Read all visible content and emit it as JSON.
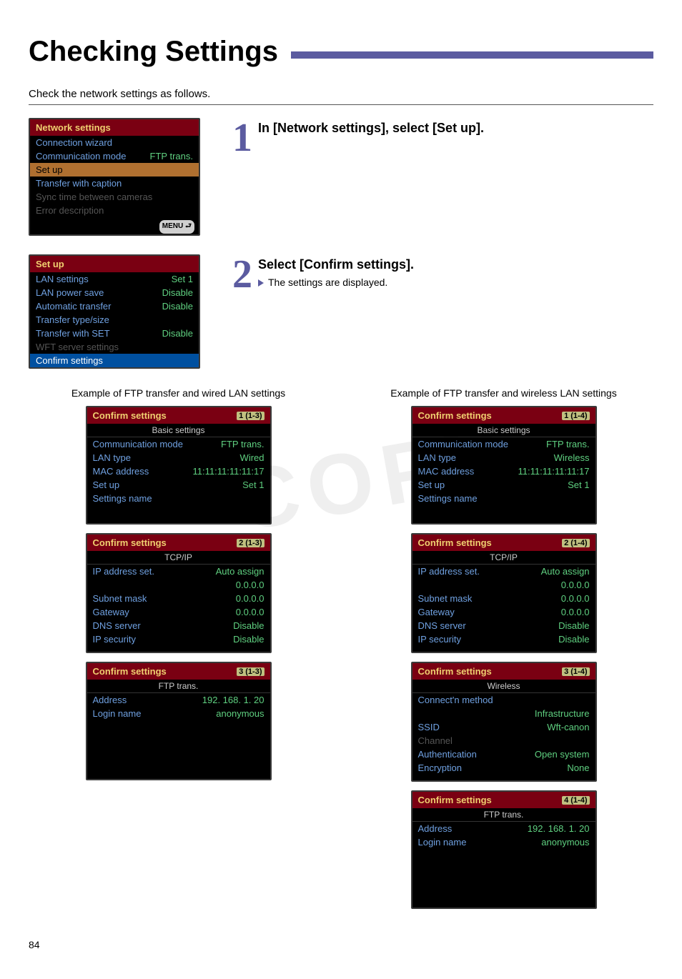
{
  "title": "Checking Settings",
  "intro": "Check the network settings as follows.",
  "page_number": "84",
  "step1": {
    "num": "1",
    "heading": "In [Network settings], select [Set up].",
    "panel": {
      "header": "Network settings",
      "items": [
        {
          "label": "Connection wizard",
          "value": ""
        },
        {
          "label": "Communication mode",
          "value": "FTP trans."
        },
        {
          "label": "Set up",
          "value": "",
          "hl": "orange"
        },
        {
          "label": "Transfer with caption",
          "value": ""
        },
        {
          "label": "Sync time between cameras",
          "value": "",
          "disabled": true
        },
        {
          "label": "Error description",
          "value": "",
          "disabled": true
        }
      ],
      "footer": "MENU ⮐"
    }
  },
  "step2": {
    "num": "2",
    "heading": "Select [Confirm settings].",
    "detail": "The settings are displayed.",
    "panel": {
      "header": "Set up",
      "items": [
        {
          "label": "LAN settings",
          "value": "Set 1"
        },
        {
          "label": "LAN power save",
          "value": "Disable"
        },
        {
          "label": "Automatic transfer",
          "value": "Disable"
        },
        {
          "label": "Transfer type/size",
          "value": ""
        },
        {
          "label": "Transfer with SET",
          "value": "Disable"
        },
        {
          "label": "WFT server settings",
          "value": "",
          "disabled": true
        },
        {
          "label": "Confirm settings",
          "value": "",
          "hl": "blue"
        }
      ]
    }
  },
  "example_left": {
    "caption": "Example of FTP transfer and wired LAN settings",
    "panels": [
      {
        "header": "Confirm settings",
        "page": "1",
        "range": "(1-3)",
        "sub": "Basic settings",
        "rows": [
          {
            "label": "Communication mode",
            "value": "FTP trans."
          },
          {
            "label": "LAN type",
            "value": "Wired"
          },
          {
            "label": "MAC address",
            "value": "11:11:11:11:11:17"
          },
          {
            "label": "Set up",
            "value": "Set 1"
          },
          {
            "label": "Settings name",
            "value": ""
          }
        ]
      },
      {
        "header": "Confirm settings",
        "page": "2",
        "range": "(1-3)",
        "sub": "TCP/IP",
        "rows": [
          {
            "label": "IP address set.",
            "value": "Auto assign"
          },
          {
            "label": "",
            "value": "0.0.0.0"
          },
          {
            "label": "Subnet mask",
            "value": "0.0.0.0"
          },
          {
            "label": "Gateway",
            "value": "0.0.0.0"
          },
          {
            "label": "DNS server",
            "value": "Disable"
          },
          {
            "label": "IP security",
            "value": "Disable"
          }
        ]
      },
      {
        "header": "Confirm settings",
        "page": "3",
        "range": "(1-3)",
        "sub": "FTP trans.",
        "rows": [
          {
            "label": "Address",
            "value": "192. 168. 1. 20"
          },
          {
            "label": "Login name",
            "value": "anonymous"
          }
        ]
      }
    ]
  },
  "example_right": {
    "caption": "Example of FTP transfer and wireless LAN settings",
    "panels": [
      {
        "header": "Confirm settings",
        "page": "1",
        "range": "(1-4)",
        "sub": "Basic settings",
        "rows": [
          {
            "label": "Communication mode",
            "value": "FTP trans."
          },
          {
            "label": "LAN type",
            "value": "Wireless"
          },
          {
            "label": "MAC address",
            "value": "11:11:11:11:11:17"
          },
          {
            "label": "Set up",
            "value": "Set 1"
          },
          {
            "label": "Settings name",
            "value": ""
          }
        ]
      },
      {
        "header": "Confirm settings",
        "page": "2",
        "range": "(1-4)",
        "sub": "TCP/IP",
        "rows": [
          {
            "label": "IP address set.",
            "value": "Auto assign"
          },
          {
            "label": "",
            "value": "0.0.0.0"
          },
          {
            "label": "Subnet mask",
            "value": "0.0.0.0"
          },
          {
            "label": "Gateway",
            "value": "0.0.0.0"
          },
          {
            "label": "DNS server",
            "value": "Disable"
          },
          {
            "label": "IP security",
            "value": "Disable"
          }
        ]
      },
      {
        "header": "Confirm settings",
        "page": "3",
        "range": "(1-4)",
        "sub": "Wireless",
        "rows": [
          {
            "label": "Connect'n method",
            "value": ""
          },
          {
            "label": "",
            "value": "Infrastructure"
          },
          {
            "label": "SSID",
            "value": "Wft-canon"
          },
          {
            "label": "Channel",
            "value": "",
            "disabled": true
          },
          {
            "label": "Authentication",
            "value": "Open system"
          },
          {
            "label": "Encryption",
            "value": "None"
          }
        ]
      },
      {
        "header": "Confirm settings",
        "page": "4",
        "range": "(1-4)",
        "sub": "FTP trans.",
        "rows": [
          {
            "label": "Address",
            "value": "192. 168. 1. 20"
          },
          {
            "label": "Login name",
            "value": "anonymous"
          }
        ]
      }
    ]
  }
}
